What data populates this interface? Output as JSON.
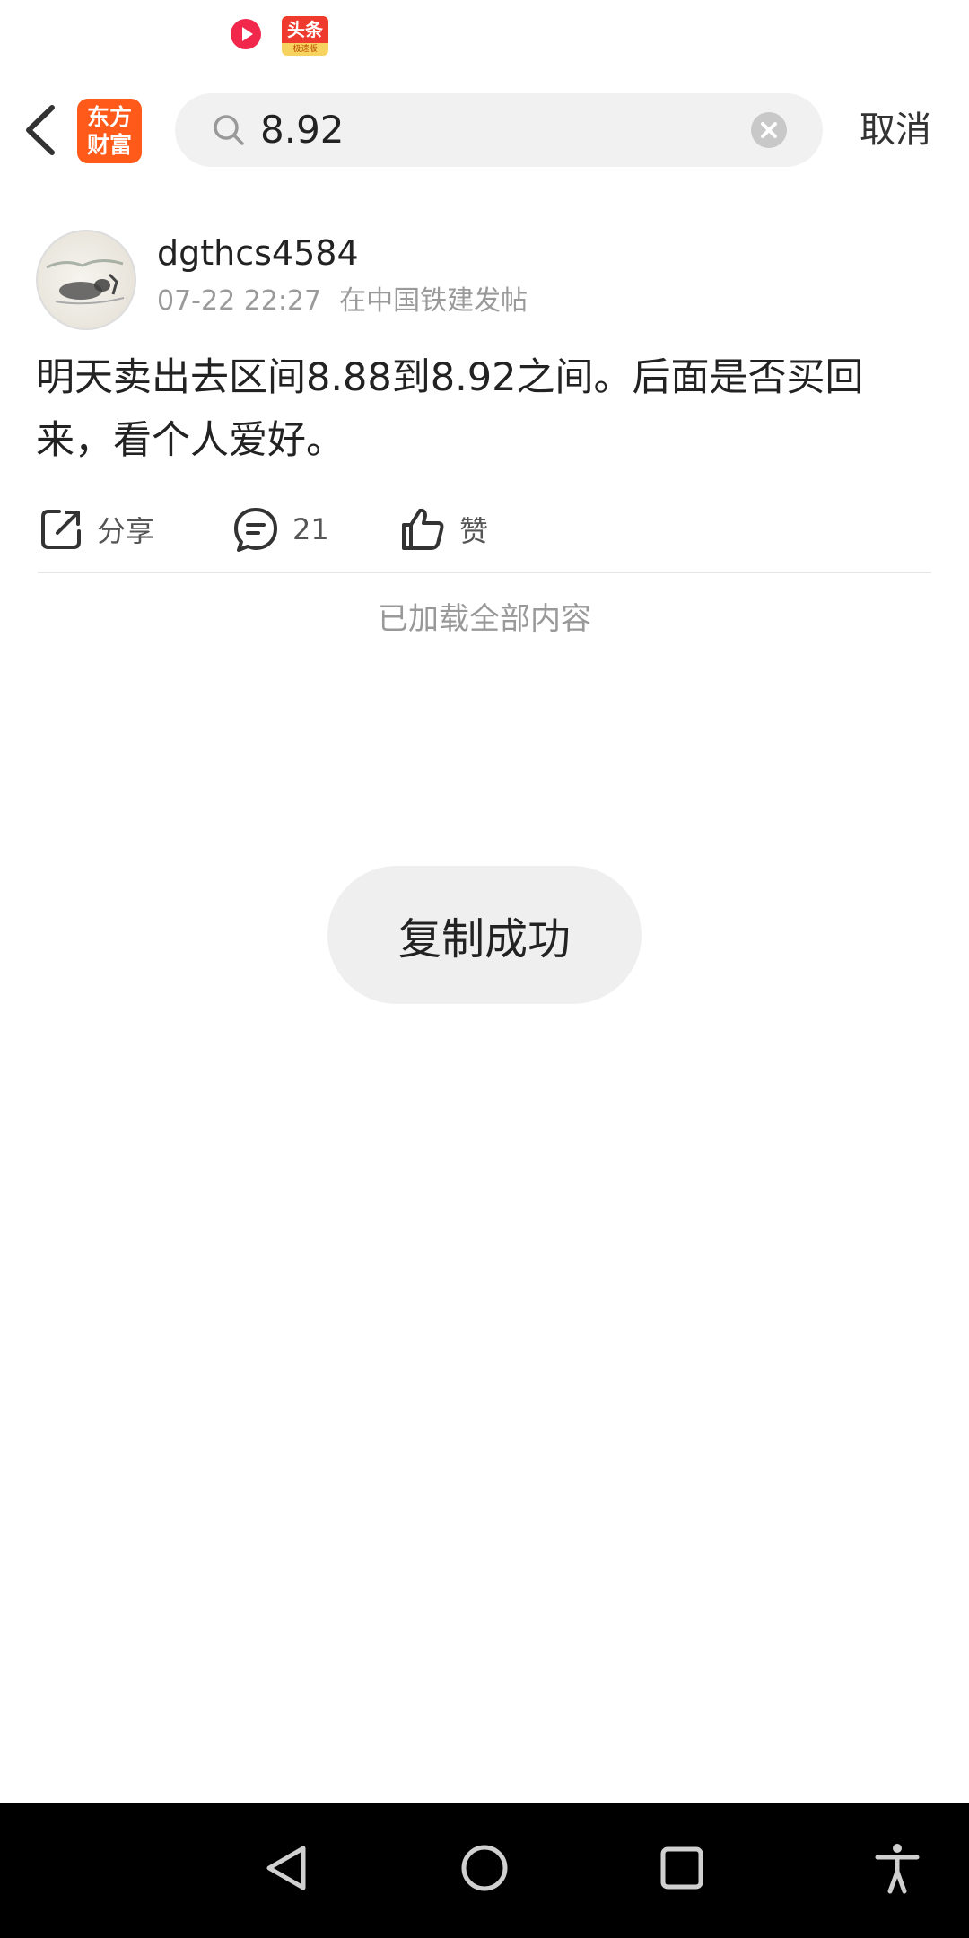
{
  "status_bar": {
    "toutiao_badge_top": "头条",
    "toutiao_badge_bottom": "极速版"
  },
  "header": {
    "app_logo_line1": "东方",
    "app_logo_line2": "财富",
    "search_value": "8.92",
    "cancel_label": "取消"
  },
  "post": {
    "username": "dgthcs4584",
    "time": "07-22 22:27",
    "location": "在中国铁建发帖",
    "text": "明天卖出去区间8.88到8.92之间。后面是否买回来，看个人爱好。",
    "actions": {
      "share_label": "分享",
      "comment_count": "21",
      "like_label": "赞"
    }
  },
  "list_footer": "已加载全部内容",
  "toast": "复制成功",
  "colors": {
    "accent": "#ff5a1a",
    "search_bg": "#f1f1f1",
    "nav_bar": "#000000"
  }
}
